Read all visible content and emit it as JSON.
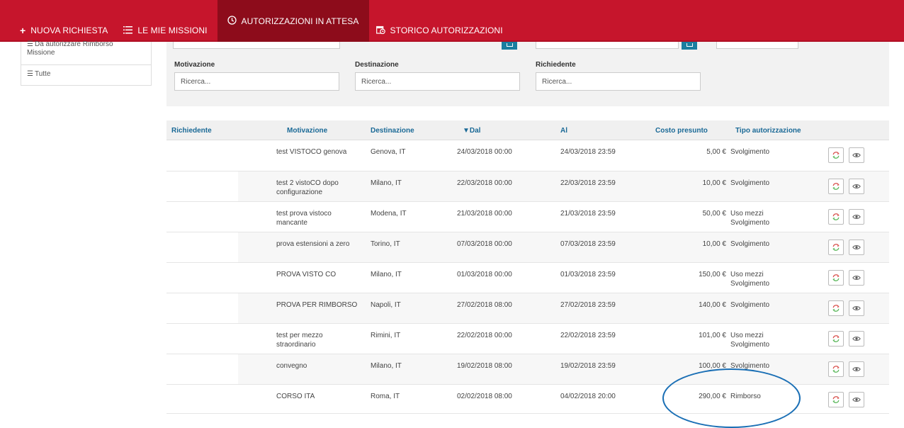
{
  "nav": {
    "items": [
      {
        "label": "NUOVA RICHIESTA",
        "icon": "plus-icon"
      },
      {
        "label": "LE MIE MISSIONI",
        "icon": "list-icon"
      },
      {
        "label": "AUTORIZZAZIONI IN ATTESA",
        "icon": "clock-icon"
      },
      {
        "label": "STORICO AUTORIZZAZIONI",
        "icon": "history-icon"
      }
    ]
  },
  "sidebar": {
    "items": [
      {
        "label": "Da autorizzare Rimborso Missione",
        "icon": "list-icon"
      },
      {
        "label": "Tutte",
        "icon": "list-icon"
      }
    ]
  },
  "filters": {
    "motivazione_label": "Motivazione",
    "destinazione_label": "Destinazione",
    "richiedente_label": "Richiedente",
    "placeholder": "Ricerca..."
  },
  "table": {
    "headers": {
      "richiedente": "Richiedente",
      "motivazione": "Motivazione",
      "destinazione": "Destinazione",
      "dal": "▼Dal",
      "al": "Al",
      "costo": "Costo presunto",
      "tipo": "Tipo autorizzazione"
    },
    "rows": [
      {
        "motivazione": "test VISTOCO genova",
        "destinazione": "Genova, IT",
        "dal": "24/03/2018 00:00",
        "al": "24/03/2018 23:59",
        "costo": "5,00 €",
        "tipo": "Svolgimento"
      },
      {
        "motivazione": "test 2 vistoCO dopo configurazione",
        "destinazione": "Milano, IT",
        "dal": "22/03/2018 00:00",
        "al": "22/03/2018 23:59",
        "costo": "10,00 €",
        "tipo": "Svolgimento"
      },
      {
        "motivazione": "test prova vistoco mancante",
        "destinazione": "Modena, IT",
        "dal": "21/03/2018 00:00",
        "al": "21/03/2018 23:59",
        "costo": "50,00 €",
        "tipo": "Uso mezzi Svolgimento"
      },
      {
        "motivazione": "prova estensioni a zero",
        "destinazione": "Torino, IT",
        "dal": "07/03/2018 00:00",
        "al": "07/03/2018 23:59",
        "costo": "10,00 €",
        "tipo": "Svolgimento"
      },
      {
        "motivazione": "PROVA VISTO CO",
        "destinazione": "Milano, IT",
        "dal": "01/03/2018 00:00",
        "al": "01/03/2018 23:59",
        "costo": "150,00 €",
        "tipo": "Uso mezzi Svolgimento"
      },
      {
        "motivazione": "PROVA PER RIMBORSO",
        "destinazione": "Napoli, IT",
        "dal": "27/02/2018 08:00",
        "al": "27/02/2018 23:59",
        "costo": "140,00 €",
        "tipo": "Svolgimento"
      },
      {
        "motivazione": "test per mezzo straordinario",
        "destinazione": "Rimini, IT",
        "dal": "22/02/2018 00:00",
        "al": "22/02/2018 23:59",
        "costo": "101,00 €",
        "tipo": "Uso mezzi Svolgimento"
      },
      {
        "motivazione": "convegno",
        "destinazione": "Milano, IT",
        "dal": "19/02/2018 08:00",
        "al": "19/02/2018 23:59",
        "costo": "100,00 €",
        "tipo": "Svolgimento"
      },
      {
        "motivazione": "CORSO ITA",
        "destinazione": "Roma, IT",
        "dal": "02/02/2018 08:00",
        "al": "04/02/2018 20:00",
        "costo": "290,00 €",
        "tipo": "Rimborso"
      }
    ]
  },
  "colors": {
    "navbar": "#c6152c",
    "nav_active": "#8d0c1b",
    "header_text": "#1a6996",
    "annotation": "#1a6fb5"
  }
}
